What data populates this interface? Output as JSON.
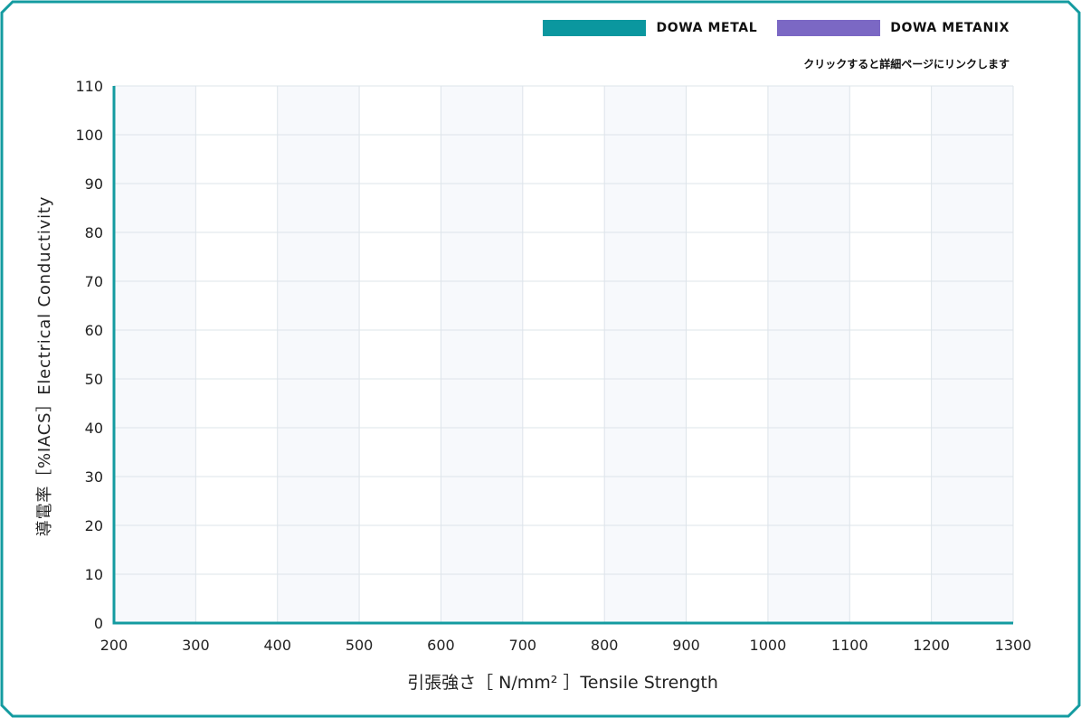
{
  "legend": [
    {
      "label": "DOWA METAL",
      "color": "#0b979f"
    },
    {
      "label": "DOWA METANIX",
      "color": "#7b68c4"
    }
  ],
  "note": "クリックすると詳細ページにリンクします",
  "colors": {
    "frame": "#149ba0",
    "axis": "#149ba0",
    "band": "#f7f9fc",
    "grid": "#dde4ea"
  },
  "chart_data": {
    "type": "scatter",
    "title": "",
    "xlabel": "引張強さ［ N/mm² ］Tensile Strength",
    "ylabel": "導電率［%IACS］Electrical Conductivity",
    "xlim": [
      200,
      1300
    ],
    "ylim": [
      0,
      110
    ],
    "xticks": [
      200,
      300,
      400,
      500,
      600,
      700,
      800,
      900,
      1000,
      1100,
      1200,
      1300
    ],
    "yticks": [
      0,
      10,
      20,
      30,
      40,
      50,
      60,
      70,
      80,
      90,
      100,
      110
    ],
    "grid": true,
    "legend_position": "top-right",
    "series": [
      {
        "name": "DOWA METAL",
        "x": [],
        "y": []
      },
      {
        "name": "DOWA METANIX",
        "x": [],
        "y": []
      }
    ]
  }
}
